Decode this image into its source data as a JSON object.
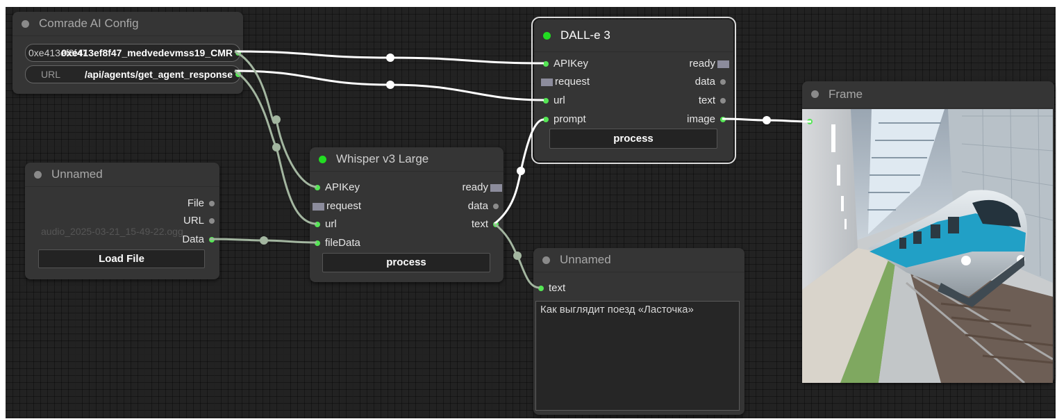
{
  "colors": {
    "canvas_bg": "#222222",
    "node_bg": "#353535",
    "slot_active": "#55e655",
    "slot_idle": "#8c8c8c",
    "title_dot_active": "#22dd22",
    "wire": "#ffffff",
    "wire_muted": "#a3b6a0"
  },
  "nodes": {
    "config": {
      "title": "Comrade AI Config",
      "field1_label": "0xe413ef8f47",
      "field1_value": "0xe413ef8f47_medvedevmss19_CMR",
      "field2_label": "URL",
      "field2_value": "/api/agents/get_agent_response"
    },
    "unnamed_file": {
      "title": "Unnamed",
      "out_file": "File",
      "out_url": "URL",
      "out_data": "Data",
      "filename": "audio_2025-03-21_15-49-22.ogg",
      "load_button": "Load File"
    },
    "whisper": {
      "title": "Whisper v3 Large",
      "in_apikey": "APIKey",
      "in_request": "request",
      "in_url": "url",
      "in_filedata": "fileData",
      "out_ready": "ready",
      "out_data": "data",
      "out_text": "text",
      "process_button": "process"
    },
    "dalle": {
      "title": "DALL-e 3",
      "in_apikey": "APIKey",
      "in_request": "request",
      "in_url": "url",
      "in_prompt": "prompt",
      "out_ready": "ready",
      "out_data": "data",
      "out_text": "text",
      "out_image": "image",
      "process_button": "process"
    },
    "unnamed_text": {
      "title": "Unnamed",
      "in_text": "text",
      "content": "Как выглядит поезд «Ласточка»"
    },
    "frame": {
      "title": "Frame",
      "image_subject": "train-station-illustration"
    }
  }
}
